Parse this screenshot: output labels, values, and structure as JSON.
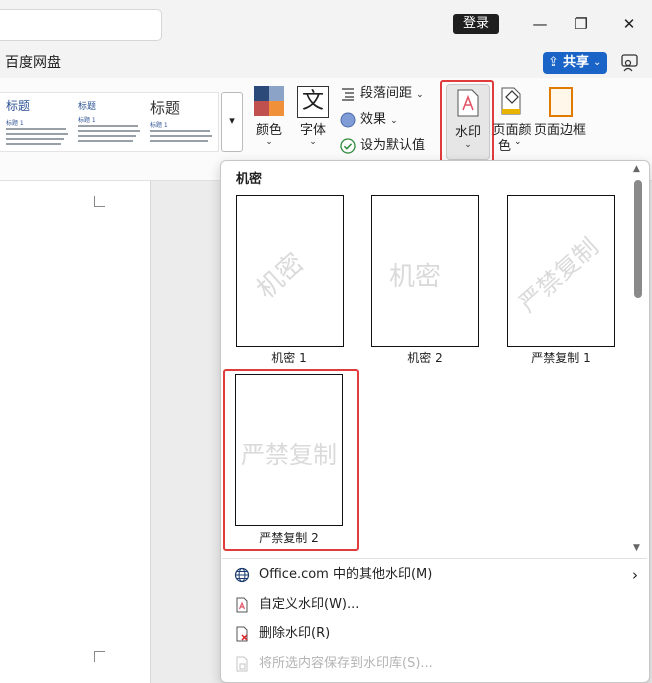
{
  "titlebar": {
    "login_label": "登录",
    "minimize": "—",
    "restore": "❐",
    "close": "✕"
  },
  "tabs": {
    "baidu": "百度网盘"
  },
  "share": {
    "label": "共享",
    "chevron": "⌄"
  },
  "styles_gallery": {
    "items": [
      {
        "title": "标题",
        "subtitle": "标题 1"
      },
      {
        "title": "标题",
        "subtitle": "标题 1"
      },
      {
        "title": "标题",
        "subtitle": "标题 1"
      }
    ]
  },
  "ribbon": {
    "color_label": "颜色",
    "font_label": "字体",
    "font_glyph": "文",
    "para_spacing": "段落间距",
    "effects": "效果",
    "set_default": "设为默认值",
    "watermark_label": "水印",
    "page_color_line1": "页面颜",
    "page_color_line2": "色",
    "page_border_label": "页面边框"
  },
  "dropdown": {
    "section_header": "机密",
    "thumbnails": [
      {
        "label": "机密 1",
        "watermark": "机密"
      },
      {
        "label": "机密 2",
        "watermark": "机密"
      },
      {
        "label": "严禁复制 1",
        "watermark": "严禁复制"
      },
      {
        "label": "严禁复制 2",
        "watermark": "严禁复制"
      }
    ],
    "menu": [
      {
        "label": "Office.com 中的其他水印(M)",
        "icon": "globe-icon",
        "arrow": "›"
      },
      {
        "label": "自定义水印(W)...",
        "icon": "custom-watermark-icon"
      },
      {
        "label": "删除水印(R)",
        "icon": "remove-watermark-icon"
      },
      {
        "label": "将所选内容保存到水印库(S)...",
        "icon": "save-gallery-icon",
        "disabled": true
      }
    ]
  },
  "colors": {
    "accent": "#1a64c8",
    "highlight": "#e03c3c"
  }
}
